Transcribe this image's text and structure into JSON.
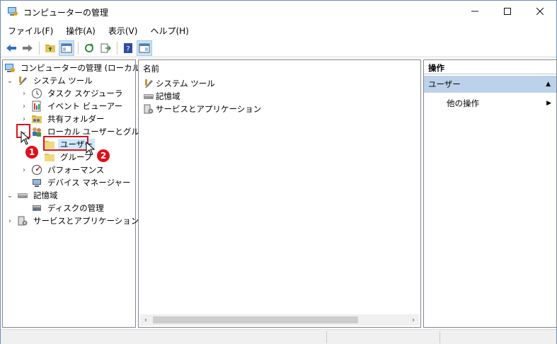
{
  "window": {
    "title": "コンピューターの管理",
    "minimize_icon": "minimize-icon",
    "maximize_icon": "maximize-icon",
    "close_icon": "close-icon"
  },
  "menu": {
    "items": [
      "ファイル(F)",
      "操作(A)",
      "表示(V)",
      "ヘルプ(H)"
    ]
  },
  "tree": {
    "root": "コンピューターの管理 (ローカル)",
    "items": [
      {
        "label": "システム ツール"
      },
      {
        "label": "タスク スケジューラ"
      },
      {
        "label": "イベント ビューアー"
      },
      {
        "label": "共有フォルダー"
      },
      {
        "label": "ローカル ユーザーとグループ"
      },
      {
        "label": "ユーザー"
      },
      {
        "label": "グループ"
      },
      {
        "label": "パフォーマンス"
      },
      {
        "label": "デバイス マネージャー"
      },
      {
        "label": "記憶域"
      },
      {
        "label": "ディスクの管理"
      },
      {
        "label": "サービスとアプリケーション"
      }
    ]
  },
  "center": {
    "header": "名前",
    "items": [
      "システム ツール",
      "記憶域",
      "サービスとアプリケーション"
    ]
  },
  "actions": {
    "title": "操作",
    "section": "ユーザー",
    "item": "他の操作"
  },
  "annotations": {
    "badge1": "1",
    "badge2": "2"
  },
  "colors": {
    "highlight": "#e0101a",
    "action_section_bg": "#bcd2ea"
  }
}
